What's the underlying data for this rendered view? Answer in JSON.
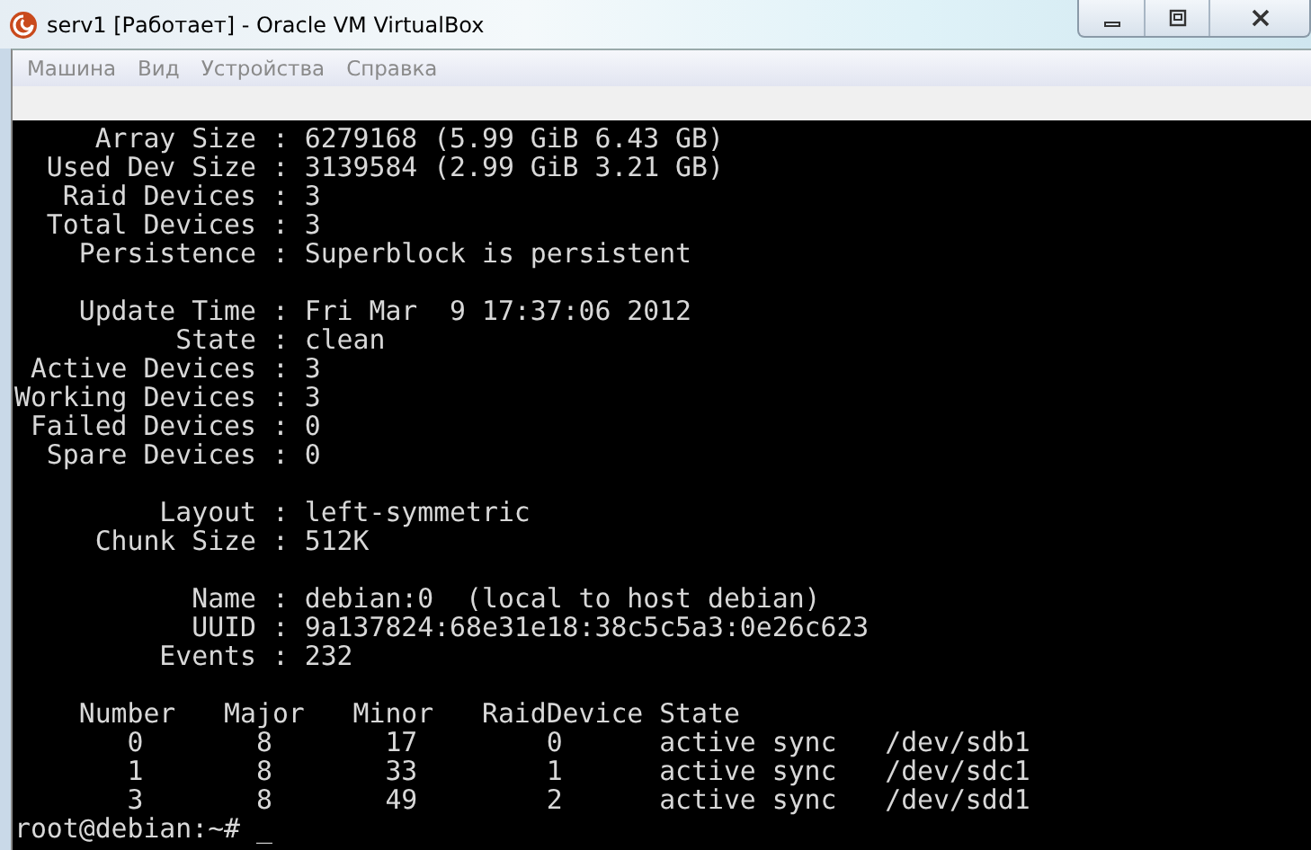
{
  "window": {
    "title": "serv1 [Работает] - Oracle VM VirtualBox"
  },
  "menu": [
    "Машина",
    "Вид",
    "Устройства",
    "Справка"
  ],
  "terminal": {
    "blocks": [
      [
        "     Array Size : 6279168 (5.99 GiB 6.43 GB)",
        "  Used Dev Size : 3139584 (2.99 GiB 3.21 GB)",
        "   Raid Devices : 3",
        "  Total Devices : 3",
        "    Persistence : Superblock is persistent"
      ],
      [
        "    Update Time : Fri Mar  9 17:37:06 2012",
        "          State : clean",
        " Active Devices : 3",
        "Working Devices : 3",
        " Failed Devices : 0",
        "  Spare Devices : 0"
      ],
      [
        "         Layout : left-symmetric",
        "     Chunk Size : 512K"
      ],
      [
        "           Name : debian:0  (local to host debian)",
        "           UUID : 9a137824:68e31e18:38c5c5a3:0e26c623",
        "         Events : 232"
      ],
      [
        "    Number   Major   Minor   RaidDevice State",
        "       0       8       17        0      active sync   /dev/sdb1",
        "       1       8       33        1      active sync   /dev/sdc1",
        "       3       8       49        2      active sync   /dev/sdd1",
        "root@debian:~# _"
      ]
    ]
  }
}
